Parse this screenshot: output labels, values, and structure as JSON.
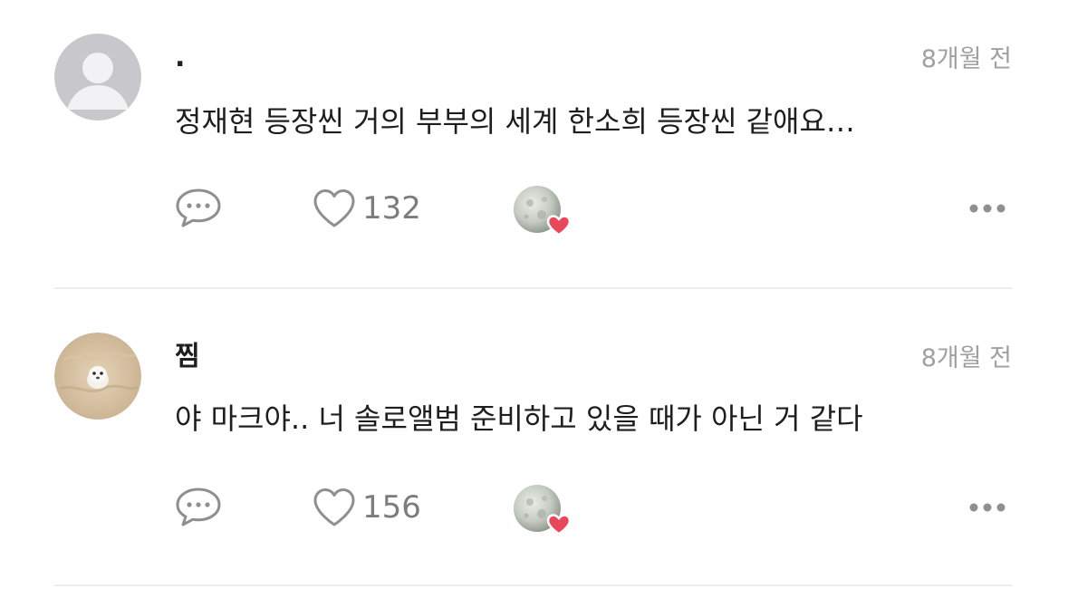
{
  "comments": [
    {
      "author": ".",
      "time": "8개월 전",
      "text": "정재현 등장씬 거의 부부의 세계 한소희 등장씬 같애요…",
      "likes": "132",
      "avatar": "default-avatar-icon"
    },
    {
      "author": "찜",
      "time": "8개월 전",
      "text": "야 마크야.. 너 솔로앨범 준비하고 있을 때가 아닌 거 같다",
      "likes": "156",
      "avatar": "seal-photo-avatar"
    }
  ],
  "colors": {
    "muted": "#a0a0a4",
    "icon": "#8e8e93",
    "heart_badge": "#e8485a",
    "divider": "#ededee"
  },
  "icons": {
    "comment": "speech-bubble-icon",
    "like": "heart-outline-icon",
    "reaction": "moon-heart-reaction-icon",
    "more": "more-dots-icon"
  }
}
